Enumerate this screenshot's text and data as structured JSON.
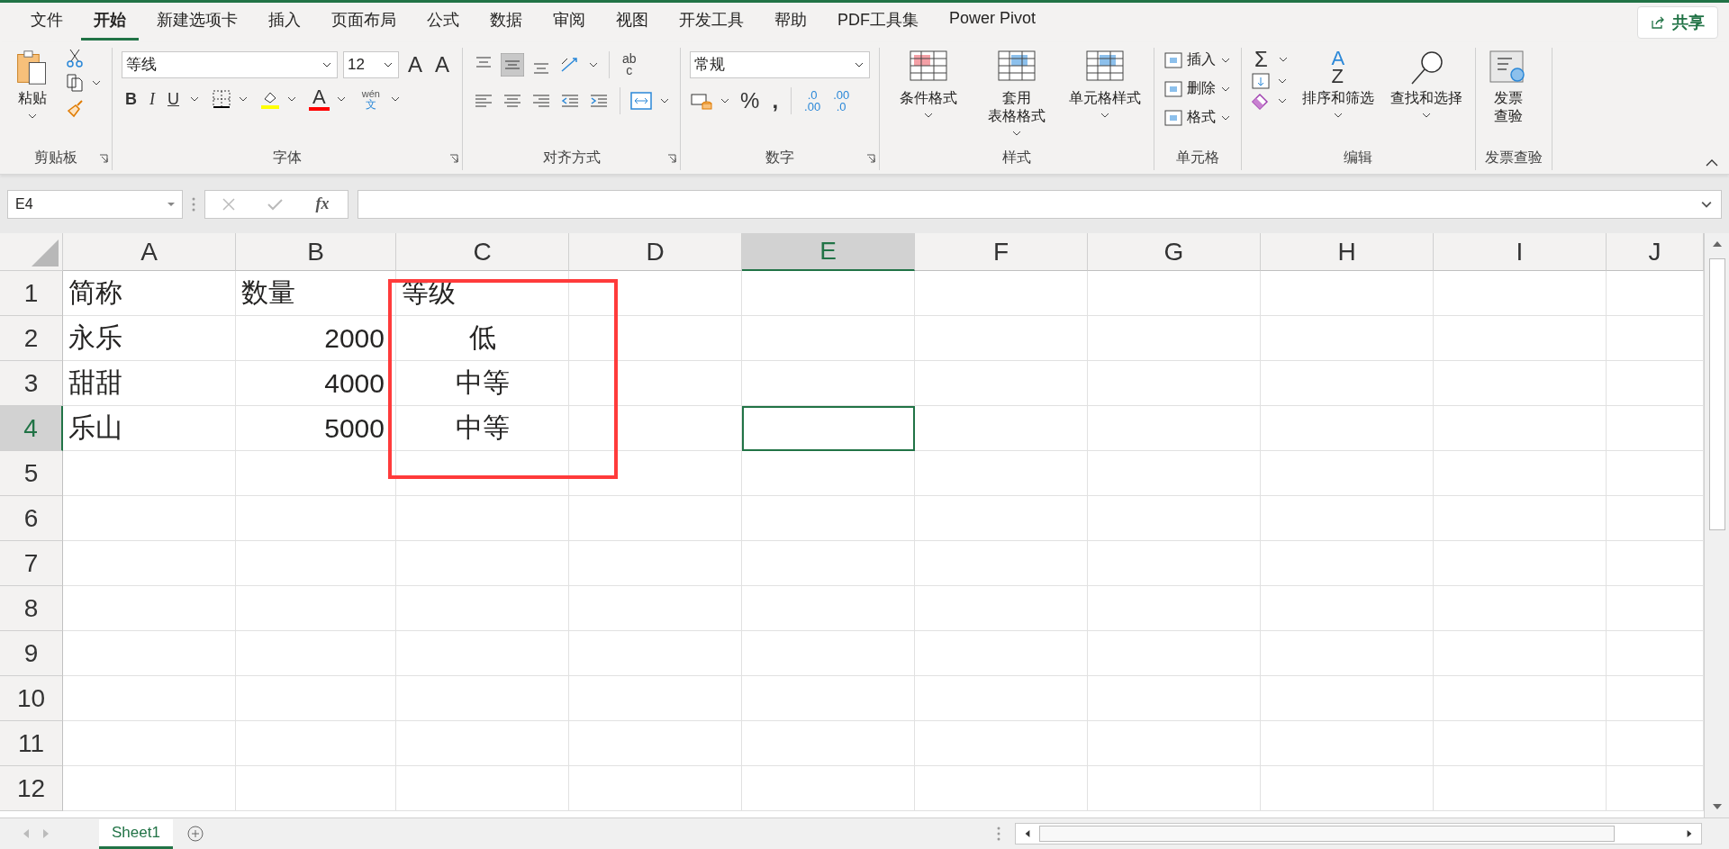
{
  "tabs": [
    {
      "label": "文件",
      "selected": false
    },
    {
      "label": "开始",
      "selected": true
    },
    {
      "label": "新建选项卡",
      "selected": false
    },
    {
      "label": "插入",
      "selected": false
    },
    {
      "label": "页面布局",
      "selected": false
    },
    {
      "label": "公式",
      "selected": false
    },
    {
      "label": "数据",
      "selected": false
    },
    {
      "label": "审阅",
      "selected": false
    },
    {
      "label": "视图",
      "selected": false
    },
    {
      "label": "开发工具",
      "selected": false
    },
    {
      "label": "帮助",
      "selected": false
    },
    {
      "label": "PDF工具集",
      "selected": false
    },
    {
      "label": "Power Pivot",
      "selected": false
    }
  ],
  "share_button": {
    "label": "共享"
  },
  "clipboard": {
    "paste": "粘贴",
    "label": "剪贴板"
  },
  "font": {
    "name": "等线",
    "size": "12",
    "grow": "A",
    "shrink": "A",
    "bold": "B",
    "italic": "I",
    "underline": "U",
    "font_color": "A",
    "phonetic_top": "wén",
    "phonetic_bottom": "文",
    "label": "字体"
  },
  "alignment": {
    "wrap_top": "ab",
    "wrap_bottom": "c",
    "label": "对齐方式"
  },
  "number": {
    "format": "常规",
    "percent": "%",
    "comma": ",",
    "increase_decimal": [
      ".0",
      ".00"
    ],
    "decrease_decimal": [
      ".00",
      ".0"
    ],
    "label": "数字"
  },
  "styles": {
    "items": [
      {
        "lines": [
          "条件格式"
        ]
      },
      {
        "lines": [
          "套用",
          "表格格式"
        ]
      },
      {
        "lines": [
          "单元格样式"
        ]
      }
    ],
    "label": "样式"
  },
  "cells": {
    "items": [
      "插入",
      "删除",
      "格式"
    ],
    "label": "单元格"
  },
  "editing": {
    "sum": "Σ",
    "sort_letters": [
      "A",
      "Z"
    ],
    "sort": "排序和筛选",
    "find": "查找和选择",
    "label": "编辑"
  },
  "invoice": {
    "lines": [
      "发票",
      "查验"
    ],
    "label": "发票查验"
  },
  "formula_bar": {
    "name_box": "E4",
    "fx": "fx"
  },
  "columns": [
    {
      "label": "A",
      "selected": false
    },
    {
      "label": "B",
      "selected": false
    },
    {
      "label": "C",
      "selected": false
    },
    {
      "label": "D",
      "selected": false
    },
    {
      "label": "E",
      "selected": true
    },
    {
      "label": "F",
      "selected": false
    },
    {
      "label": "G",
      "selected": false
    },
    {
      "label": "H",
      "selected": false
    },
    {
      "label": "I",
      "selected": false
    },
    {
      "label": "J",
      "selected": false
    }
  ],
  "rows": [
    {
      "header": "1",
      "selected": false,
      "cells": [
        {
          "text": "简称",
          "kind": "left"
        },
        {
          "text": "数量",
          "kind": "left"
        },
        {
          "text": "等级",
          "kind": "left"
        }
      ]
    },
    {
      "header": "2",
      "selected": false,
      "cells": [
        {
          "text": "永乐",
          "kind": "left"
        },
        {
          "text": "2000",
          "kind": "right"
        },
        {
          "text": "低",
          "kind": "center"
        }
      ]
    },
    {
      "header": "3",
      "selected": false,
      "cells": [
        {
          "text": "甜甜",
          "kind": "left"
        },
        {
          "text": "4000",
          "kind": "right"
        },
        {
          "text": "中等",
          "kind": "center"
        }
      ]
    },
    {
      "header": "4",
      "selected": true,
      "cells": [
        {
          "text": "乐山",
          "kind": "left"
        },
        {
          "text": "5000",
          "kind": "right"
        },
        {
          "text": "中等",
          "kind": "center"
        }
      ]
    },
    {
      "header": "5",
      "selected": false,
      "cells": []
    },
    {
      "header": "6",
      "selected": false,
      "cells": []
    },
    {
      "header": "7",
      "selected": false,
      "cells": []
    },
    {
      "header": "8",
      "selected": false,
      "cells": []
    },
    {
      "header": "9",
      "selected": false,
      "cells": []
    },
    {
      "header": "10",
      "selected": false,
      "cells": []
    },
    {
      "header": "11",
      "selected": false,
      "cells": []
    },
    {
      "header": "12",
      "selected": false,
      "cells": []
    }
  ],
  "sheet_tabs": [
    {
      "label": "Sheet1",
      "selected": true
    }
  ]
}
